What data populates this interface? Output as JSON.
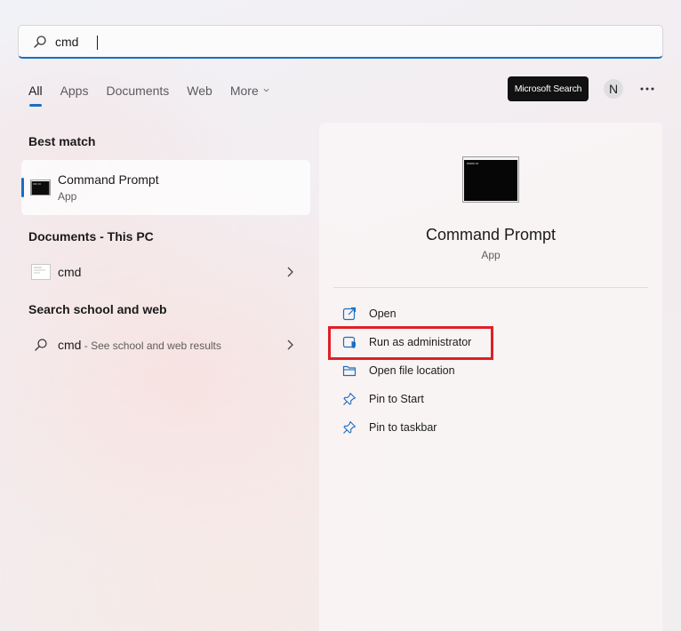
{
  "search": {
    "value": "cmd",
    "placeholder": ""
  },
  "tabs": [
    {
      "label": "All",
      "active": true
    },
    {
      "label": "Apps"
    },
    {
      "label": "Documents"
    },
    {
      "label": "Web"
    },
    {
      "label": "More"
    }
  ],
  "header": {
    "microsoft_search_label": "Microsoft Search",
    "avatar_initial": "N"
  },
  "left": {
    "best_match_title": "Best match",
    "best_match": {
      "title": "Command Prompt",
      "subtitle": "App"
    },
    "documents_title": "Documents - This PC",
    "documents": [
      {
        "label": "cmd"
      }
    ],
    "web_title": "Search school and web",
    "web": {
      "query": "cmd",
      "hint": " - See school and web results"
    }
  },
  "right": {
    "app_title": "Command Prompt",
    "app_subtitle": "App",
    "actions": [
      {
        "label": "Open",
        "icon": "open-external-icon"
      },
      {
        "label": "Run as administrator",
        "icon": "shield-admin-icon"
      },
      {
        "label": "Open file location",
        "icon": "folder-icon"
      },
      {
        "label": "Pin to Start",
        "icon": "pin-icon"
      },
      {
        "label": "Pin to taskbar",
        "icon": "pin-icon"
      }
    ]
  },
  "colors": {
    "accent": "#1a6fc1",
    "highlight_box": "#e01f26"
  }
}
